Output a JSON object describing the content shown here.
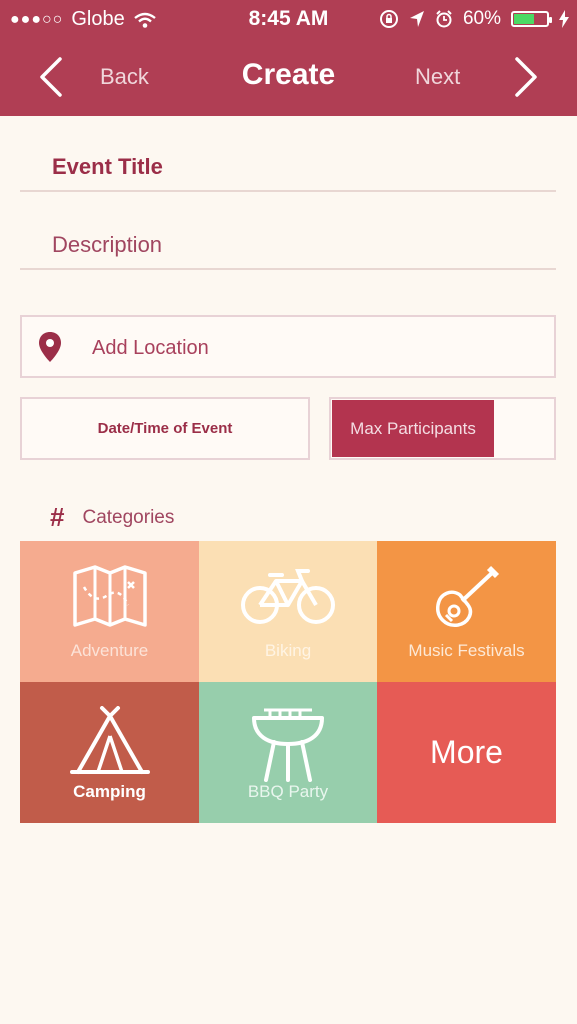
{
  "status_bar": {
    "carrier": "Globe",
    "signal": "●●●○○",
    "time": "8:45 AM",
    "battery": "60%",
    "battery_level": 0.6,
    "battery_color": "#4cd964"
  },
  "nav": {
    "back_label": "Back",
    "title": "Create",
    "next_label": "Next"
  },
  "form": {
    "event_title": "Event Title",
    "description": "Description",
    "location": "Add Location",
    "datetime": "Date/Time of Event",
    "max_participants": "Max Participants"
  },
  "categories": {
    "heading_icon": "#",
    "heading": "Categories",
    "items": [
      {
        "label": "Adventure",
        "icon": "map-icon",
        "color": "#f5ab8f"
      },
      {
        "label": "Biking",
        "icon": "bicycle-icon",
        "color": "#fbdfb4"
      },
      {
        "label": "Music Festivals",
        "icon": "guitar-icon",
        "color": "#f39545"
      },
      {
        "label": "Camping",
        "icon": "tent-icon",
        "color": "#c15c4a"
      },
      {
        "label": "BBQ Party",
        "icon": "grill-icon",
        "color": "#97ceac"
      },
      {
        "label": "More",
        "icon": "",
        "color": "#e65b55"
      }
    ]
  },
  "colors": {
    "header": "#b03e54",
    "accent": "#9b2e48",
    "background": "#fdf8f1"
  }
}
